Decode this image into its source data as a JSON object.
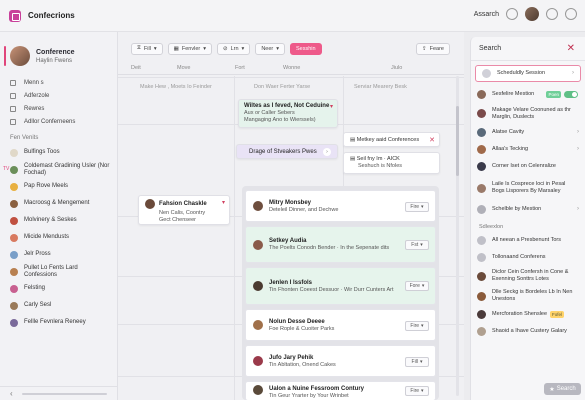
{
  "app": {
    "title": "Confecrions"
  },
  "topbar": {
    "search_label": "Assarch"
  },
  "profile": {
    "name": "Conference",
    "sub": "Haylin Fwens"
  },
  "nav": [
    {
      "label": "Menn s"
    },
    {
      "label": "Adferzole"
    },
    {
      "label": "Rewres"
    },
    {
      "label": "Adllor Conferneens"
    }
  ],
  "venues_label": "Fen Venits",
  "venues": [
    {
      "label": "Bulfings Toos",
      "color": "#e0d8c8"
    },
    {
      "label": "Coldemast Gradining Usler (Nor Fochad)",
      "color": "#6b8f5a"
    },
    {
      "label": "Pap Rove Meels",
      "color": "#e8b040"
    },
    {
      "label": "Macroosg & Mengement",
      "color": "#8a6040"
    },
    {
      "label": "Molvinery & Seskes",
      "color": "#c05040"
    },
    {
      "label": "Micide Mendusts",
      "color": "#d87a60"
    },
    {
      "label": "Jelr Pross",
      "color": "#7a9fc8"
    },
    {
      "label": "Pullet Lo Fents Lard Confessions",
      "color": "#b88050"
    },
    {
      "label": "Felsting",
      "color": "#c86090"
    },
    {
      "label": "Carly Sesl",
      "color": "#9a7a5a"
    },
    {
      "label": "Fellle Fevnlera Reneey",
      "color": "#7a6a9a"
    }
  ],
  "toolbar": {
    "btn1": "Fill",
    "btn2": "Fenvler",
    "btn3": "Lrn",
    "btn4": "Neer",
    "accent": "Sesshin",
    "right": "Feare"
  },
  "columns": [
    "Deit",
    "Move",
    "Fort",
    "Wonne",
    "Jiulo"
  ],
  "subcolumns": [
    "Make Hew , Moets Io Feinder",
    "Don Waer Ferter Yarse",
    "Serviar Mearery Besk"
  ],
  "cards": {
    "green_title": "Wiltes as I feved, Not Ceduine",
    "green_line1": "Aux or Caller Sebers",
    "green_line2": "Mangaging Ano to Wierssels)",
    "purple_title": "Drage of Stveakers Pwes",
    "meetup_title": "Metkey aaid Conferences",
    "sell_title": "Seil fny Im · AICK",
    "sell_sub": "Seshuch is Nfoles",
    "fashion_title": "Fahsion Chaskle",
    "fashion_line1": "Nen Calis, Coontry",
    "fashion_line2": "Gect Chenseer"
  },
  "lineup": [
    {
      "title": "Mitry Monsbey",
      "sub": "Deteleil Dinner, and Dechwe",
      "pill": "Fire",
      "avatar": "#6e4e3e",
      "green": false
    },
    {
      "title": "Setkey Audia",
      "sub": "The Poelts Conodn Bender · In the Sepenate dits",
      "pill": "Fst",
      "avatar": "#8a5a4a",
      "green": true
    },
    {
      "title": "Jenlen I Issfols",
      "sub": "Tin Fhonten Coeest Dessuor · Wir Durr Cunters Art",
      "pill": "Fore",
      "avatar": "#4a3a30",
      "green": true
    },
    {
      "title": "Nolun Desse Deeee",
      "sub": "Foe Rople & Cuoiter Parks",
      "pill": "Fire",
      "avatar": "#a0704a",
      "green": false
    },
    {
      "title": "Jufo Jary Pehik",
      "sub": "Tin Abltation, Onend Cakes",
      "pill": "Fill",
      "avatar": "#9a3a4a",
      "green": false
    },
    {
      "title": "Ualon a Nuine Fessroom Contury",
      "sub": "Tin Geur Yrarter by Your Wrinbet",
      "pill": "Fire",
      "avatar": "#5a4a3a",
      "green": false
    }
  ],
  "rpanel": {
    "search": "Search",
    "items_top": [
      {
        "label": "Scheduldly Session",
        "color": "#d0d0d8",
        "hl": true
      },
      {
        "label": "Sesfelire Mestion",
        "color": "#8a6a5a",
        "toggle": true,
        "badge": "Poen"
      },
      {
        "label": "Makage Velare Coonuned as thr Marglin, Duslects",
        "color": "#7a4a4a"
      },
      {
        "label": "Alatse Cavity",
        "color": "#5a6a7a"
      },
      {
        "label": "Allaa's Tecking",
        "color": "#a06a4a"
      },
      {
        "label": "Corner Iset on Celenralize",
        "color": "#3a3a4a"
      },
      {
        "label": "Laile Is Cosprece loci in Pesal Bogs Lisporers By Marsaley",
        "color": "#9a7a6a"
      },
      {
        "label": "Schelble by Mestion",
        "color": "#b0b0b8"
      }
    ],
    "section": "Sdleexlon",
    "items_bottom": [
      {
        "label": "All neean a Presbenunt Tors",
        "color": "#c0c0c8"
      },
      {
        "label": "Tollonaand Conferens",
        "color": "#c0c0c8"
      },
      {
        "label": "Diclor Cein Confersh in Cone & Exenning Sonttrs Lotes",
        "color": "#6a4a3a"
      },
      {
        "label": "Dlle Seckg is Bordeles Lb In Nen Unestons",
        "color": "#8a5a3a"
      },
      {
        "label": "Mercforation Shenslee",
        "color": "#4a3a3a",
        "badge": "Fofel"
      },
      {
        "label": "Shaoid a Ihave Custery Galary",
        "color": "#b0a090"
      }
    ],
    "foot_button": "Search"
  }
}
